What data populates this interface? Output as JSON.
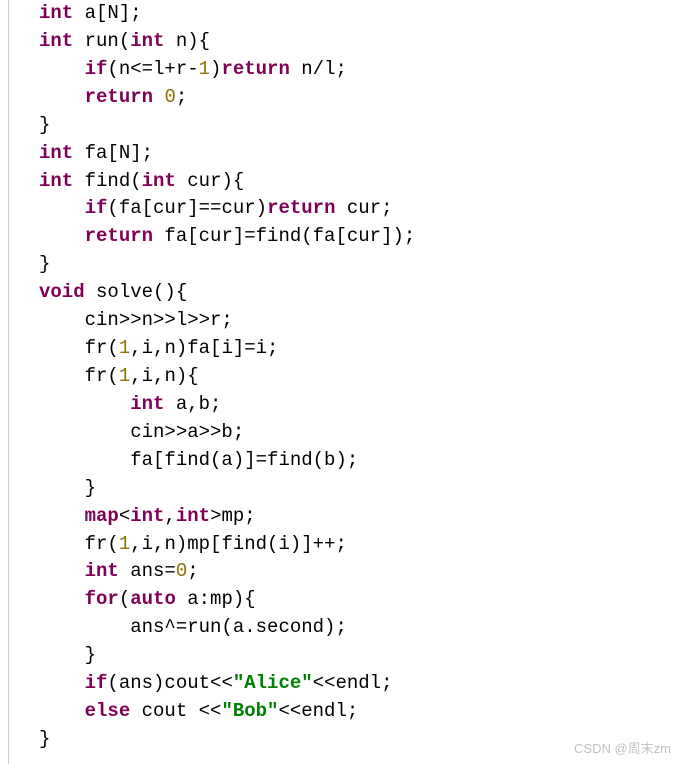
{
  "code": {
    "lines": [
      [
        {
          "c": "type",
          "t": "int"
        },
        {
          "c": "ident",
          "t": " a[N];"
        }
      ],
      [
        {
          "c": "type",
          "t": "int"
        },
        {
          "c": "ident",
          "t": " run("
        },
        {
          "c": "type",
          "t": "int"
        },
        {
          "c": "ident",
          "t": " n){"
        }
      ],
      [
        {
          "c": "ident",
          "t": "    "
        },
        {
          "c": "kw",
          "t": "if"
        },
        {
          "c": "ident",
          "t": "(n<=l+r-"
        },
        {
          "c": "num",
          "t": "1"
        },
        {
          "c": "ident",
          "t": ")"
        },
        {
          "c": "kw",
          "t": "return"
        },
        {
          "c": "ident",
          "t": " n/l;"
        }
      ],
      [
        {
          "c": "ident",
          "t": "    "
        },
        {
          "c": "kw",
          "t": "return"
        },
        {
          "c": "ident",
          "t": " "
        },
        {
          "c": "num",
          "t": "0"
        },
        {
          "c": "ident",
          "t": ";"
        }
      ],
      [
        {
          "c": "ident",
          "t": "}"
        }
      ],
      [
        {
          "c": "type",
          "t": "int"
        },
        {
          "c": "ident",
          "t": " fa[N];"
        }
      ],
      [
        {
          "c": "type",
          "t": "int"
        },
        {
          "c": "ident",
          "t": " find("
        },
        {
          "c": "type",
          "t": "int"
        },
        {
          "c": "ident",
          "t": " cur){"
        }
      ],
      [
        {
          "c": "ident",
          "t": "    "
        },
        {
          "c": "kw",
          "t": "if"
        },
        {
          "c": "ident",
          "t": "(fa[cur]==cur)"
        },
        {
          "c": "kw",
          "t": "return"
        },
        {
          "c": "ident",
          "t": " cur;"
        }
      ],
      [
        {
          "c": "ident",
          "t": "    "
        },
        {
          "c": "kw",
          "t": "return"
        },
        {
          "c": "ident",
          "t": " fa[cur]=find(fa[cur]);"
        }
      ],
      [
        {
          "c": "ident",
          "t": "}"
        }
      ],
      [
        {
          "c": "type",
          "t": "void"
        },
        {
          "c": "ident",
          "t": " solve(){"
        }
      ],
      [
        {
          "c": "ident",
          "t": "    cin>>n>>l>>r;"
        }
      ],
      [
        {
          "c": "ident",
          "t": "    fr("
        },
        {
          "c": "num",
          "t": "1"
        },
        {
          "c": "ident",
          "t": ",i,n)fa[i]=i;"
        }
      ],
      [
        {
          "c": "ident",
          "t": "    fr("
        },
        {
          "c": "num",
          "t": "1"
        },
        {
          "c": "ident",
          "t": ",i,n){"
        }
      ],
      [
        {
          "c": "ident",
          "t": "        "
        },
        {
          "c": "type",
          "t": "int"
        },
        {
          "c": "ident",
          "t": " a,b;"
        }
      ],
      [
        {
          "c": "ident",
          "t": "        cin>>a>>b;"
        }
      ],
      [
        {
          "c": "ident",
          "t": "        fa[find(a)]=find(b);"
        }
      ],
      [
        {
          "c": "ident",
          "t": "    }"
        }
      ],
      [
        {
          "c": "ident",
          "t": "    "
        },
        {
          "c": "tmpl",
          "t": "map"
        },
        {
          "c": "ident",
          "t": "<"
        },
        {
          "c": "type",
          "t": "int"
        },
        {
          "c": "ident",
          "t": ","
        },
        {
          "c": "type",
          "t": "int"
        },
        {
          "c": "ident",
          "t": ">mp;"
        }
      ],
      [
        {
          "c": "ident",
          "t": "    fr("
        },
        {
          "c": "num",
          "t": "1"
        },
        {
          "c": "ident",
          "t": ",i,n)mp[find(i)]++;"
        }
      ],
      [
        {
          "c": "ident",
          "t": "    "
        },
        {
          "c": "type",
          "t": "int"
        },
        {
          "c": "ident",
          "t": " ans="
        },
        {
          "c": "num",
          "t": "0"
        },
        {
          "c": "ident",
          "t": ";"
        }
      ],
      [
        {
          "c": "ident",
          "t": "    "
        },
        {
          "c": "kw",
          "t": "for"
        },
        {
          "c": "ident",
          "t": "("
        },
        {
          "c": "kw",
          "t": "auto"
        },
        {
          "c": "ident",
          "t": " a:mp){"
        }
      ],
      [
        {
          "c": "ident",
          "t": "        ans^=run(a.second);"
        }
      ],
      [
        {
          "c": "ident",
          "t": "    }"
        }
      ],
      [
        {
          "c": "ident",
          "t": "    "
        },
        {
          "c": "kw",
          "t": "if"
        },
        {
          "c": "ident",
          "t": "(ans)cout<<"
        },
        {
          "c": "str",
          "t": "\"Alice\""
        },
        {
          "c": "ident",
          "t": "<<endl;"
        }
      ],
      [
        {
          "c": "ident",
          "t": "    "
        },
        {
          "c": "kw",
          "t": "else"
        },
        {
          "c": "ident",
          "t": " cout <<"
        },
        {
          "c": "str",
          "t": "\"Bob\""
        },
        {
          "c": "ident",
          "t": "<<endl;"
        }
      ],
      [
        {
          "c": "ident",
          "t": "}"
        }
      ]
    ]
  },
  "watermark": "CSDN @周末zm"
}
